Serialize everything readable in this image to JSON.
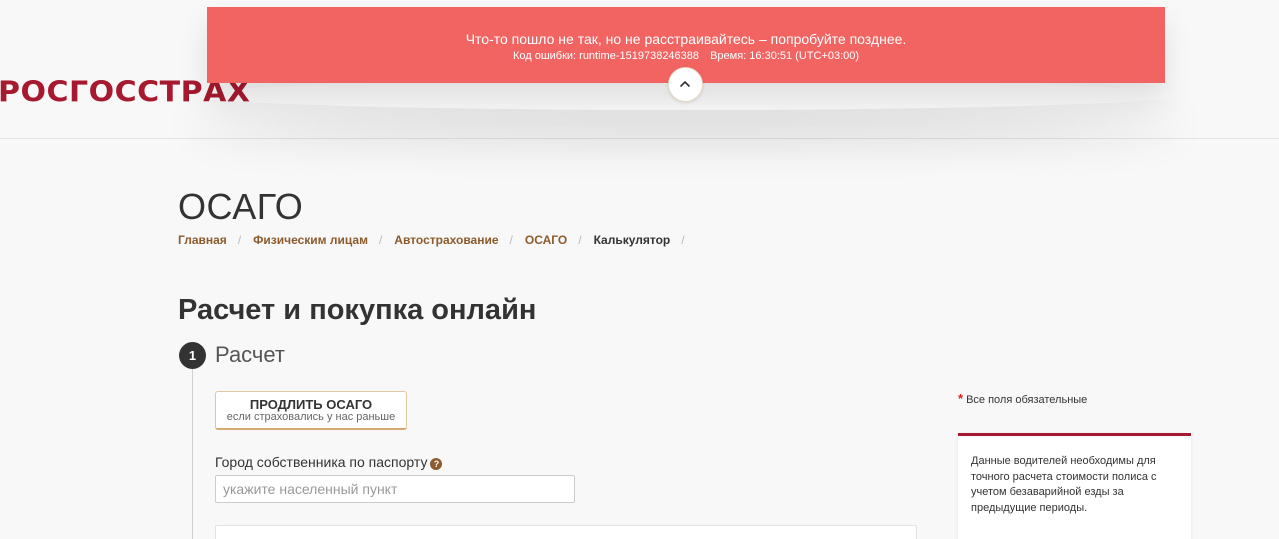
{
  "error": {
    "title": "Что-то пошло не так, но не расстраивайтесь – попробуйте позднее.",
    "code_text": "Код ошибки: runtime-1519738246388",
    "time_text": "Время: 16:30:51 (UTC+03:00)",
    "collapse_icon": "chevron-up-icon"
  },
  "header": {
    "logo": "РОСГОССТРАХ",
    "brand_color": "#a6192e"
  },
  "page": {
    "title": "ОСАГО"
  },
  "breadcrumb": [
    {
      "label": "Главная"
    },
    {
      "label": "Физическим лицам"
    },
    {
      "label": "Автострахование"
    },
    {
      "label": "ОСАГО"
    },
    {
      "label": "Калькулятор"
    }
  ],
  "breadcrumb_sep": "/",
  "section": {
    "title": "Расчет и покупка онлайн"
  },
  "step": {
    "number": "1",
    "label": "Расчет"
  },
  "renew_button": {
    "label": "ПРОДЛИТЬ ОСАГО",
    "sublabel": "если страховались у нас раньше"
  },
  "city_field": {
    "label": "Город собственника по паспорту",
    "help_glyph": "?",
    "value": "",
    "placeholder": "укажите населенный пункт"
  },
  "required_note": {
    "star": "*",
    "text": "Все поля обязательные"
  },
  "info_box": {
    "text": "Данные водителей необходимы для точного расчета стоимости полиса с учетом безаварийной езды за предыдущие периоды."
  },
  "colors": {
    "error_bg": "#f16462",
    "link": "#8c5a2b",
    "required_star": "#e31e24"
  }
}
